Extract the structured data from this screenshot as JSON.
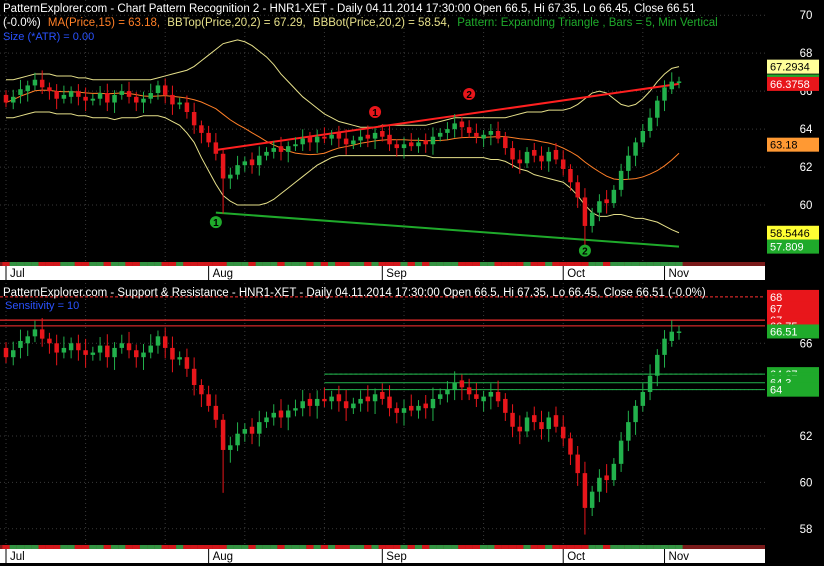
{
  "colors": {
    "background": "#000000",
    "up": "#22b14c",
    "down": "#e8161b",
    "grid": "#3a3a3a",
    "axis_text": "#000000",
    "axis_bg": "#ffffff",
    "text": "#ffffff",
    "ma": "#ff7f27",
    "bb": "#e6e08a",
    "bbbot": "#ffff33",
    "pattern_upper": "#ff2020",
    "pattern_lower": "#1faa2b",
    "sr_line": "#22b14c",
    "resist": "#ff3030",
    "info_blue": "#2a52ff",
    "info_green": "#1faa2b"
  },
  "top_panel": {
    "title": "PatternExplorer.com - Chart Pattern Recognition 2 - HNR1-XET - Daily 04.11.2014 17:30:00 Open 66.5, Hi 67.35, Lo 66.45, Close 66.51",
    "line2_prefix": "(-0.0%)",
    "ma_label": "MA(Price,15) = 63.18,",
    "bbtop_label": "BBTop(Price,20,2) = 67.29,",
    "bbbot_label": "BBBot(Price,20,2) = 58.54,",
    "pattern_label": "Pattern: Expanding Triangle , Bars = 5, Min Vertical",
    "size_label": "Size (*ATR) = 0.00",
    "y_ticks": [
      "70",
      "68",
      "66",
      "64",
      "62",
      "60"
    ],
    "price_tags": [
      {
        "text": "67.2934",
        "bg": "#ffff99",
        "fg": "#000000"
      },
      {
        "text": "66.51",
        "bg": "#1faa2b",
        "fg": "#ffffff"
      },
      {
        "text": "66.3758",
        "bg": "#e8161b",
        "fg": "#ffffff"
      },
      {
        "text": "63.18",
        "bg": "#ff9933",
        "fg": "#000000"
      },
      {
        "text": "58.5446",
        "bg": "#ffff33",
        "fg": "#000000"
      },
      {
        "text": "57.809",
        "bg": "#1faa2b",
        "fg": "#ffffff"
      }
    ],
    "markers": [
      {
        "label": "1",
        "color": "#e8161b"
      },
      {
        "label": "2",
        "color": "#e8161b"
      },
      {
        "label": "1",
        "color": "#1faa2b"
      },
      {
        "label": "2",
        "color": "#1faa2b"
      }
    ]
  },
  "bottom_panel": {
    "title": "PatternExplorer.com - Support & Resistance - HNR1-XET - Daily 04.11.2014 17:30:00 Open 66.5, Hi 67.35, Lo 66.45, Close 66.51 (-0.0%)",
    "sensitivity_label": "Sensitivity = 10",
    "y_ticks": [
      "66",
      "64",
      "62",
      "60",
      "58"
    ],
    "price_tags": [
      {
        "text": "68",
        "bg": "#e8161b",
        "fg": "#ffffff"
      },
      {
        "text": "67",
        "bg": "#e8161b",
        "fg": "#ffffff"
      },
      {
        "text": "67",
        "bg": "#e8161b",
        "fg": "#ffffff"
      },
      {
        "text": "66.75",
        "bg": "#e8161b",
        "fg": "#ffffff"
      },
      {
        "text": "66.51",
        "bg": "#1faa2b",
        "fg": "#ffffff"
      },
      {
        "text": "64.67",
        "bg": "#1faa2b",
        "fg": "#ffffff"
      },
      {
        "text": "64.67",
        "bg": "#1faa2b",
        "fg": "#ffffff"
      },
      {
        "text": "64.3",
        "bg": "#1faa2b",
        "fg": "#ffffff"
      },
      {
        "text": "64",
        "bg": "#1faa2b",
        "fg": "#ffffff"
      }
    ]
  },
  "x_axis": {
    "labels": [
      "Jul",
      "Aug",
      "Sep",
      "Oct",
      "Nov"
    ]
  },
  "chart_data": {
    "type": "candlestick",
    "symbol": "HNR1-XET",
    "last": {
      "date": "04.11.2014 17:30:00",
      "open": 66.5,
      "high": 67.35,
      "low": 66.45,
      "close": 66.51,
      "change": "-0.0%"
    },
    "indicators": {
      "MA(Price,15)": 63.18,
      "BBTop(Price,20,2)": 67.29,
      "BBBot(Price,20,2)": 58.54
    },
    "pattern": {
      "name": "Expanding Triangle",
      "bars": 5
    },
    "sensitivity": 10,
    "closes": [
      65.4,
      65.7,
      66.1,
      66.3,
      66.6,
      66.2,
      66.0,
      65.6,
      65.8,
      66.0,
      65.7,
      65.5,
      65.6,
      65.9,
      65.4,
      65.8,
      66.0,
      65.7,
      65.4,
      65.6,
      65.9,
      66.3,
      65.8,
      65.3,
      65.4,
      64.9,
      64.2,
      63.8,
      63.3,
      62.7,
      61.4,
      61.6,
      62.1,
      62.3,
      62.1,
      62.6,
      62.8,
      63.0,
      62.8,
      63.1,
      63.2,
      63.5,
      63.3,
      63.6,
      63.5,
      63.7,
      63.5,
      63.2,
      63.4,
      63.6,
      63.5,
      63.8,
      63.6,
      63.2,
      63.0,
      63.2,
      63.1,
      63.3,
      63.2,
      63.6,
      63.8,
      64.0,
      64.3,
      64.1,
      63.8,
      63.6,
      63.7,
      63.9,
      63.5,
      63.0,
      62.4,
      62.2,
      62.8,
      62.6,
      62.3,
      62.8,
      62.4,
      61.9,
      61.2,
      60.4,
      58.9,
      59.6,
      60.2,
      60.1,
      60.8,
      61.8,
      62.6,
      63.3,
      63.9,
      64.6,
      65.5,
      66.2,
      66.5,
      66.51
    ],
    "opens": [
      65.8,
      65.4,
      65.8,
      66.0,
      66.3,
      66.6,
      66.2,
      66.0,
      65.6,
      65.7,
      66.0,
      65.7,
      65.5,
      65.6,
      65.9,
      65.4,
      65.8,
      66.0,
      65.7,
      65.4,
      65.6,
      65.9,
      66.3,
      65.8,
      65.3,
      65.4,
      64.9,
      64.2,
      63.8,
      63.3,
      62.7,
      61.4,
      61.6,
      62.1,
      62.4,
      62.1,
      62.6,
      62.8,
      63.1,
      62.8,
      63.1,
      63.2,
      63.6,
      63.3,
      63.6,
      63.5,
      63.8,
      63.5,
      63.2,
      63.4,
      63.7,
      63.5,
      63.9,
      63.7,
      63.2,
      63.0,
      63.3,
      63.1,
      63.4,
      63.2,
      63.6,
      63.8,
      64.0,
      64.4,
      64.1,
      63.8,
      63.5,
      63.7,
      63.9,
      63.6,
      63.0,
      62.4,
      62.2,
      62.9,
      62.6,
      62.3,
      62.9,
      62.4,
      61.9,
      61.2,
      60.4,
      58.9,
      59.6,
      60.3,
      60.1,
      60.8,
      61.8,
      62.6,
      63.3,
      63.9,
      64.6,
      65.5,
      66.1,
      66.5
    ],
    "bb_top": [
      66.6,
      66.6,
      66.7,
      66.8,
      66.9,
      66.9,
      66.9,
      66.8,
      66.8,
      66.8,
      66.7,
      66.7,
      66.6,
      66.6,
      66.6,
      66.6,
      66.6,
      66.6,
      66.6,
      66.6,
      66.6,
      66.7,
      66.8,
      66.9,
      67.0,
      67.1,
      67.3,
      67.6,
      67.9,
      68.2,
      68.5,
      68.6,
      68.7,
      68.6,
      68.4,
      68.1,
      67.8,
      67.4,
      66.9,
      66.5,
      66.1,
      65.7,
      65.4,
      65.1,
      64.8,
      64.6,
      64.4,
      64.3,
      64.2,
      64.1,
      64.1,
      64.1,
      64.2,
      64.2,
      64.2,
      64.2,
      64.2,
      64.2,
      64.2,
      64.3,
      64.4,
      64.5,
      64.6,
      64.6,
      64.6,
      64.6,
      64.6,
      64.6,
      64.6,
      64.6,
      64.7,
      64.8,
      64.9,
      64.9,
      64.9,
      65.0,
      65.0,
      65.0,
      65.1,
      65.3,
      65.6,
      65.9,
      66.0,
      65.9,
      65.6,
      65.3,
      65.2,
      65.3,
      65.6,
      66.0,
      66.5,
      66.9,
      67.2,
      67.29
    ],
    "bb_bot": [
      64.6,
      64.6,
      64.7,
      64.8,
      64.9,
      64.9,
      64.9,
      64.8,
      64.8,
      64.8,
      64.7,
      64.7,
      64.6,
      64.6,
      64.6,
      64.5,
      64.6,
      64.6,
      64.6,
      64.7,
      64.7,
      64.7,
      64.6,
      64.4,
      64.2,
      63.8,
      63.3,
      62.5,
      61.8,
      61.1,
      60.5,
      60.2,
      60.0,
      60.0,
      60.0,
      60.0,
      60.1,
      60.3,
      60.6,
      60.9,
      61.2,
      61.5,
      61.8,
      62.1,
      62.3,
      62.5,
      62.6,
      62.6,
      62.6,
      62.6,
      62.6,
      62.6,
      62.6,
      62.6,
      62.6,
      62.6,
      62.6,
      62.6,
      62.6,
      62.5,
      62.5,
      62.5,
      62.5,
      62.5,
      62.5,
      62.5,
      62.5,
      62.4,
      62.4,
      62.3,
      62.1,
      61.9,
      61.8,
      61.6,
      61.5,
      61.4,
      61.3,
      61.2,
      60.9,
      60.5,
      60.0,
      59.6,
      59.4,
      59.4,
      59.5,
      59.5,
      59.4,
      59.3,
      59.3,
      59.2,
      59.1,
      58.9,
      58.7,
      58.54
    ],
    "support_resistance_levels": [
      68,
      67,
      67,
      66.75,
      64.67,
      64.67,
      64.3,
      64
    ],
    "y_range_top": [
      57,
      70.8
    ],
    "y_range_bottom": [
      57.3,
      68.6
    ],
    "x_labels": [
      "Jul",
      "Aug",
      "Sep",
      "Oct",
      "Nov"
    ]
  }
}
